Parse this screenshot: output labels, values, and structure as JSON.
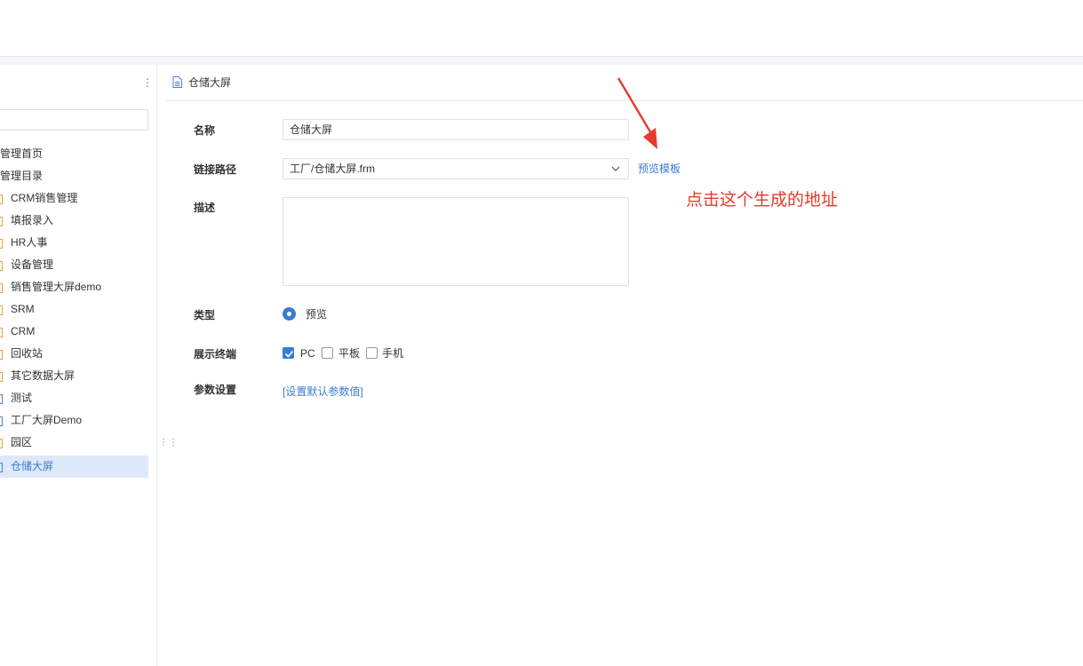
{
  "header": {
    "page_title": "仓储大屏"
  },
  "sidebar": {
    "more_icon": "more-vertical-icon",
    "search": {
      "value": "",
      "placeholder": ""
    },
    "items": [
      {
        "label": "管理首页",
        "level": "root"
      },
      {
        "label": "管理目录",
        "level": "root"
      },
      {
        "label": "CRM销售管理",
        "level": "child",
        "icon": "folder-icon"
      },
      {
        "label": "填报录入",
        "level": "child",
        "icon": "folder-icon"
      },
      {
        "label": "HR人事",
        "level": "child",
        "icon": "folder-icon"
      },
      {
        "label": "设备管理",
        "level": "child",
        "icon": "folder-icon"
      },
      {
        "label": "销售管理大屏demo",
        "level": "child",
        "icon": "folder-icon"
      },
      {
        "label": "SRM",
        "level": "child",
        "icon": "folder-icon"
      },
      {
        "label": "CRM",
        "level": "child",
        "icon": "folder-icon"
      },
      {
        "label": "回收站",
        "level": "child",
        "icon": "folder-icon"
      },
      {
        "label": "其它数据大屏",
        "level": "child",
        "icon": "folder-icon"
      },
      {
        "label": "测试",
        "level": "child",
        "icon": "file-icon"
      },
      {
        "label": "工厂大屏Demo",
        "level": "child",
        "icon": "file-icon"
      },
      {
        "label": "园区",
        "level": "child",
        "icon": "folder-icon"
      },
      {
        "label": "仓储大屏",
        "level": "child",
        "icon": "file-icon",
        "selected": true
      }
    ]
  },
  "form": {
    "name_label": "名称",
    "name_value": "仓储大屏",
    "path_label": "链接路径",
    "path_value": "工厂/仓储大屏.frm",
    "preview_link": "预览模板",
    "desc_label": "描述",
    "desc_value": "",
    "type_label": "类型",
    "type_option": "预览",
    "terminal_label": "展示终端",
    "terminals": [
      {
        "label": "PC",
        "checked": true
      },
      {
        "label": "平板",
        "checked": false
      },
      {
        "label": "手机",
        "checked": false
      }
    ],
    "params_label": "参数设置",
    "params_link": "[设置默认参数值]"
  },
  "annotation": {
    "text": "点击这个生成的地址",
    "color": "#e53a2c"
  },
  "colors": {
    "accent": "#3a7bd5",
    "selected_bg": "#dde9f8",
    "folder": "#e2a33a"
  }
}
